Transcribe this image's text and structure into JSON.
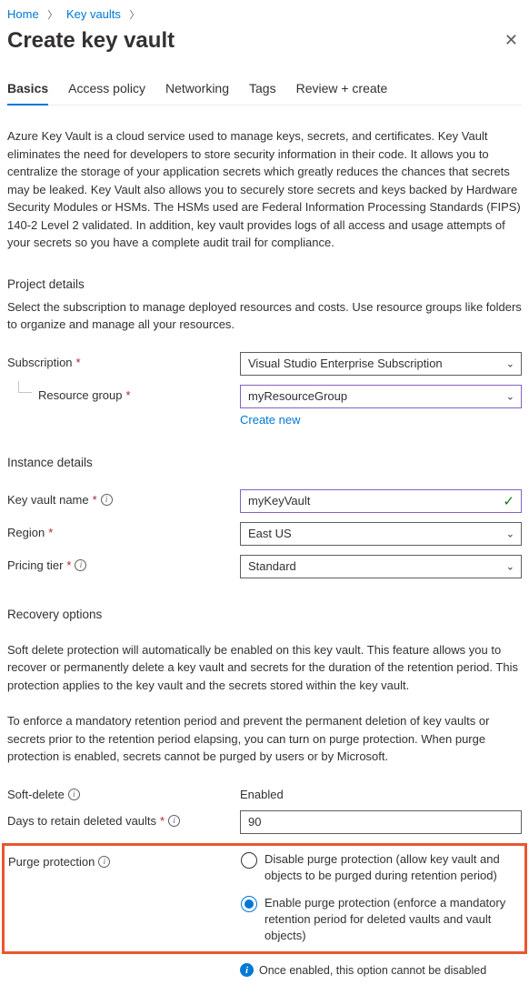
{
  "breadcrumb": {
    "home": "Home",
    "kv": "Key vaults"
  },
  "title": "Create key vault",
  "tabs": {
    "basics": "Basics",
    "access": "Access policy",
    "networking": "Networking",
    "tags": "Tags",
    "review": "Review + create"
  },
  "intro": "Azure Key Vault is a cloud service used to manage keys, secrets, and certificates. Key Vault eliminates the need for developers to store security information in their code. It allows you to centralize the storage of your application secrets which greatly reduces the chances that secrets may be leaked. Key Vault also allows you to securely store secrets and keys backed by Hardware Security Modules or HSMs. The HSMs used are Federal Information Processing Standards (FIPS) 140-2 Level 2 validated. In addition, key vault provides logs of all access and usage attempts of your secrets so you have a complete audit trail for compliance.",
  "project": {
    "heading": "Project details",
    "desc": "Select the subscription to manage deployed resources and costs. Use resource groups like folders to organize and manage all your resources.",
    "subscription_label": "Subscription",
    "subscription_value": "Visual Studio Enterprise Subscription",
    "rg_label": "Resource group",
    "rg_value": "myResourceGroup",
    "create_new": "Create new"
  },
  "instance": {
    "heading": "Instance details",
    "name_label": "Key vault name",
    "name_value": "myKeyVault",
    "region_label": "Region",
    "region_value": "East US",
    "tier_label": "Pricing tier",
    "tier_value": "Standard"
  },
  "recovery": {
    "heading": "Recovery options",
    "desc1": "Soft delete protection will automatically be enabled on this key vault. This feature allows you to recover or permanently delete a key vault and secrets for the duration of the retention period. This protection applies to the key vault and the secrets stored within the key vault.",
    "desc2": "To enforce a mandatory retention period and prevent the permanent deletion of key vaults or secrets prior to the retention period elapsing, you can turn on purge protection. When purge protection is enabled, secrets cannot be purged by users or by Microsoft.",
    "soft_delete_label": "Soft-delete",
    "soft_delete_value": "Enabled",
    "days_label": "Days to retain deleted vaults",
    "days_value": "90",
    "purge_label": "Purge protection",
    "purge_opt1": "Disable purge protection (allow key vault and objects to be purged during retention period)",
    "purge_opt2": "Enable purge protection (enforce a mandatory retention period for deleted vaults and vault objects)",
    "note": "Once enabled, this option cannot be disabled"
  }
}
